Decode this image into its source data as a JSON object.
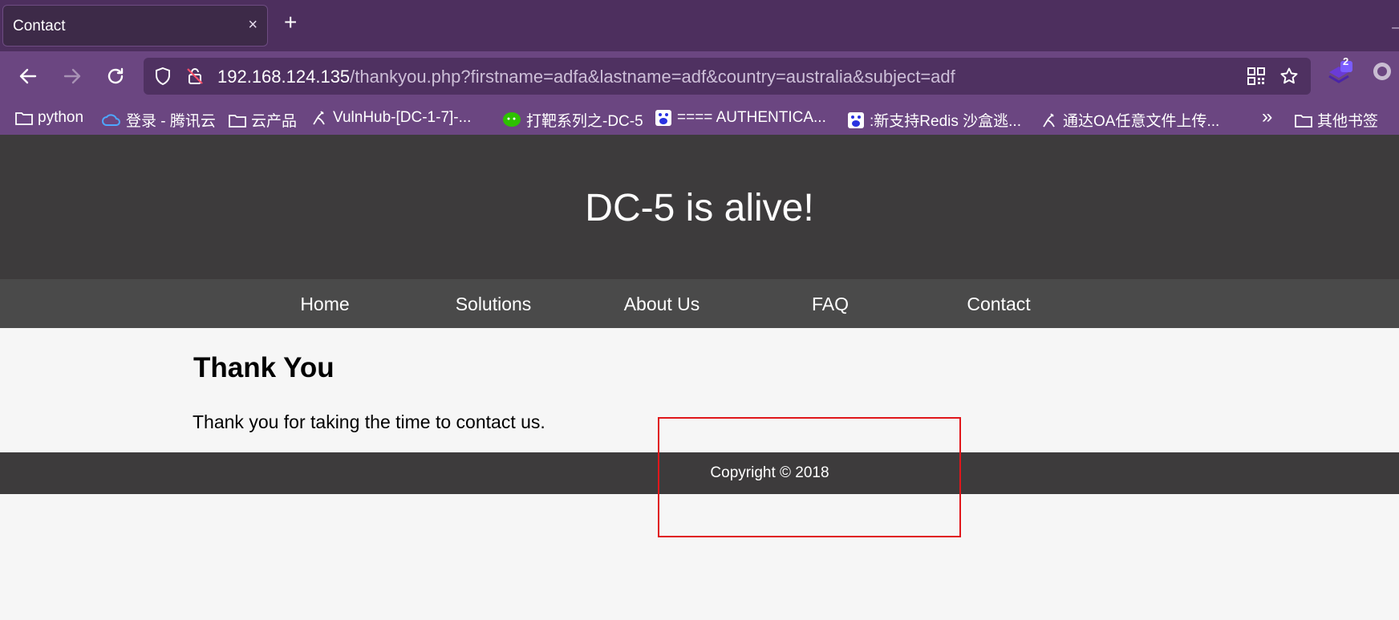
{
  "browser": {
    "tab": {
      "title": "Contact",
      "close": "×"
    },
    "new_tab": "+",
    "url": {
      "host": "192.168.124.135",
      "path": "/thankyou.php?firstname=adfa&lastname=adf&country=australia&subject=adf"
    },
    "extension_badge": "2",
    "icons": {
      "back": "back-arrow-icon",
      "forward": "forward-arrow-icon",
      "reload": "reload-icon",
      "shield": "shield-icon",
      "insecure": "insecure-lock-icon",
      "qr": "qr-code-icon",
      "star": "star-icon",
      "extension": "extension-icon"
    },
    "bookmarks": [
      {
        "label": "python",
        "icon": "folder-icon"
      },
      {
        "label": "登录 - 腾讯云",
        "icon": "tencent-cloud-icon"
      },
      {
        "label": "云产品",
        "icon": "folder-icon"
      },
      {
        "label": "VulnHub-[DC-1-7]-...",
        "icon": "site-icon"
      },
      {
        "label": "打靶系列之-DC-5",
        "icon": "wechat-icon"
      },
      {
        "label": "==== AUTHENTICA...",
        "icon": "baidu-icon"
      },
      {
        "label": ":新支持Redis 沙盒逃...",
        "icon": "baidu-icon"
      },
      {
        "label": "通达OA任意文件上传...",
        "icon": "site-icon"
      }
    ],
    "bookmarks_overflow": "»",
    "other_bookmarks": "其他书签"
  },
  "site": {
    "title": "DC-5 is alive!",
    "nav": [
      "Home",
      "Solutions",
      "About Us",
      "FAQ",
      "Contact"
    ],
    "heading": "Thank You",
    "message": "Thank you for taking the time to contact us.",
    "footer": "Copyright © 2018"
  },
  "colors": {
    "tabbar": "#4d2f5e",
    "toolbar": "#6b4681",
    "header": "#3d3b3c",
    "nav": "#4a4a4a",
    "page_bg": "#f6f6f6",
    "annotation": "#e0161b"
  }
}
